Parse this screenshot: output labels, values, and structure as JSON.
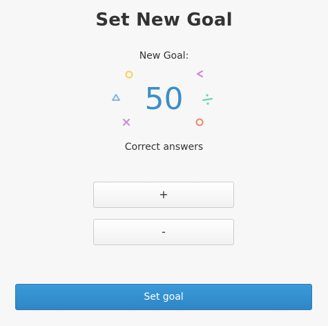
{
  "header": {
    "title": "Set New Goal"
  },
  "goal": {
    "label": "New Goal:",
    "value": "50",
    "unit_label": "Correct answers"
  },
  "decorations": {
    "icons": [
      {
        "name": "circle-icon",
        "color": "#f5d56a"
      },
      {
        "name": "less-than-icon",
        "color": "#c98fd8"
      },
      {
        "name": "triangle-icon",
        "color": "#7eb6e0"
      },
      {
        "name": "divide-icon",
        "color": "#6cd2b4"
      },
      {
        "name": "multiply-icon",
        "color": "#c98fd8"
      },
      {
        "name": "circle-icon",
        "color": "#ee8e7a"
      }
    ]
  },
  "controls": {
    "increment_label": "+",
    "decrement_label": "-",
    "submit_label": "Set goal"
  },
  "colors": {
    "accent": "#3b8ec8",
    "primary_button": "#3390d2",
    "background": "#f7f7f7"
  }
}
